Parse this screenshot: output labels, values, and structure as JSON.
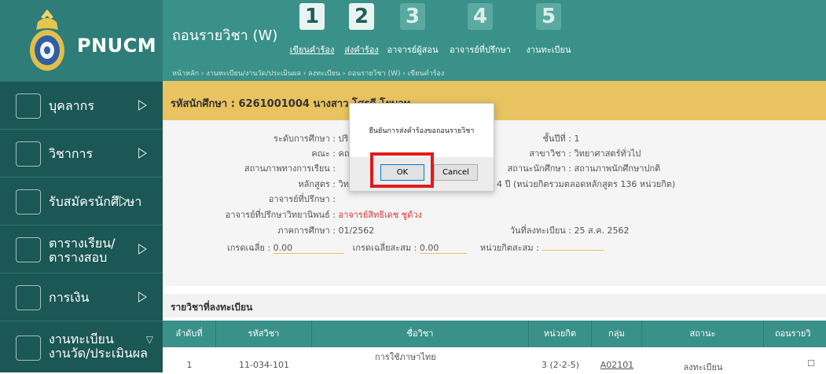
{
  "sidebar": {
    "brand": "PNUCM",
    "items": [
      {
        "label": "บุคลากร",
        "icon": "person-icon"
      },
      {
        "label": "วิชาการ",
        "icon": "book-icon"
      },
      {
        "label": "รับสมัครนักศึกษา",
        "icon": "notebook-icon"
      },
      {
        "label_line1": "ตารางเรียน/",
        "label_line2": "ตารางสอบ",
        "icon": "calendar-icon"
      },
      {
        "label": "การเงิน",
        "icon": "money-icon"
      },
      {
        "label_line1": "งานทะเบียน",
        "label_line2": "งานวัด/ประเมินผล",
        "icon": "registry-icon"
      }
    ]
  },
  "header": {
    "title": "ถอนรายวิชา (W)",
    "steps": [
      {
        "num": "1",
        "label": "เขียนคำร้อง",
        "active": true
      },
      {
        "num": "2",
        "label": "ส่งคำร้อง",
        "active": true
      },
      {
        "num": "3",
        "label": "อาจารย์ผู้สอน",
        "active": false
      },
      {
        "num": "4",
        "label": "อาจารย์ที่ปรึกษา",
        "active": false
      },
      {
        "num": "5",
        "label": "งานทะเบียน",
        "active": false
      }
    ],
    "breadcrumb": "หน้าหลัก › งานทะเบียน/งานวัด/ประเมินผล › ลงทะเบียน › ถอนรายวิชา (W) › เขียนคำร้อง"
  },
  "student": {
    "label": "รหัสนักศึกษา : 6261001004 นางสาว โศรดี โยบอท"
  },
  "info": {
    "level_label": "ระดับการศึกษา :",
    "level_value": "ปริญญาตรี 4",
    "faculty_label": "คณะ :",
    "faculty_value": "คณะวิทยาศา",
    "status_label": "สถานภาพทางการเรียน :",
    "curriculum_label": "หลักสูตร :",
    "curriculum_value": "วิทยาศาสตร",
    "curriculum_note": "4 ปี (หน่วยกิตรวมตลอดหลักสูตร 136 หน่วยกิต)",
    "advisor_label": "อาจารย์ที่ปรึกษา :",
    "thesis_advisor_label": "อาจารย์ที่ปรึกษาวิทยานิพนธ์ :",
    "thesis_advisor_value": "อาจารย์สิทธิเดช ชูด้วง",
    "semester_label": "ภาคการศึกษา :",
    "semester_value": "01/2562",
    "gpa_label": "เกรดเฉลี่ย :",
    "gpa_value": "0.00",
    "gpax_label": "เกรดเฉลี่ยสะสม :",
    "gpax_value": "0.00",
    "credits_label": "หน่วยกิตสะสม :",
    "year_label": "ชั้นปีที่ :",
    "year_value": "1",
    "major_label": "สาขาวิชา :",
    "major_value": "วิทยาศาสตร์ทั่วไป",
    "student_status_label": "สถานะนักศึกษา :",
    "student_status_value": "สถานภาพนักศึกษาปกติ",
    "reg_date_label": "วันที่ลงทะเบียน :",
    "reg_date_value": "25 ส.ค. 2562"
  },
  "courses": {
    "title": "รายวิชาที่ลงทะเบียน",
    "columns": [
      "ลำดับที่",
      "รหัสวิชา",
      "ชื่อวิชา",
      "หน่วยกิต",
      "กลุ่ม",
      "สถานะ",
      "ถอนรายวิ"
    ],
    "rows": [
      {
        "no": "1",
        "code": "11-034-101",
        "name": "การใช้ภาษาไทย",
        "credit": "3 (2-2-5)",
        "group": "A02101",
        "status": "ลงทะเบียน",
        "withdraw": "☐"
      }
    ]
  },
  "dialog": {
    "message": "ยืนยันการส่งคำร้องขอถอนรายวิชา",
    "ok_label": "OK",
    "cancel_label": "Cancel"
  },
  "colors": {
    "sidebar": "#1f5f5b",
    "header": "#3a9189",
    "student_bar": "#e8c35f",
    "highlight": "#e01b1b"
  }
}
